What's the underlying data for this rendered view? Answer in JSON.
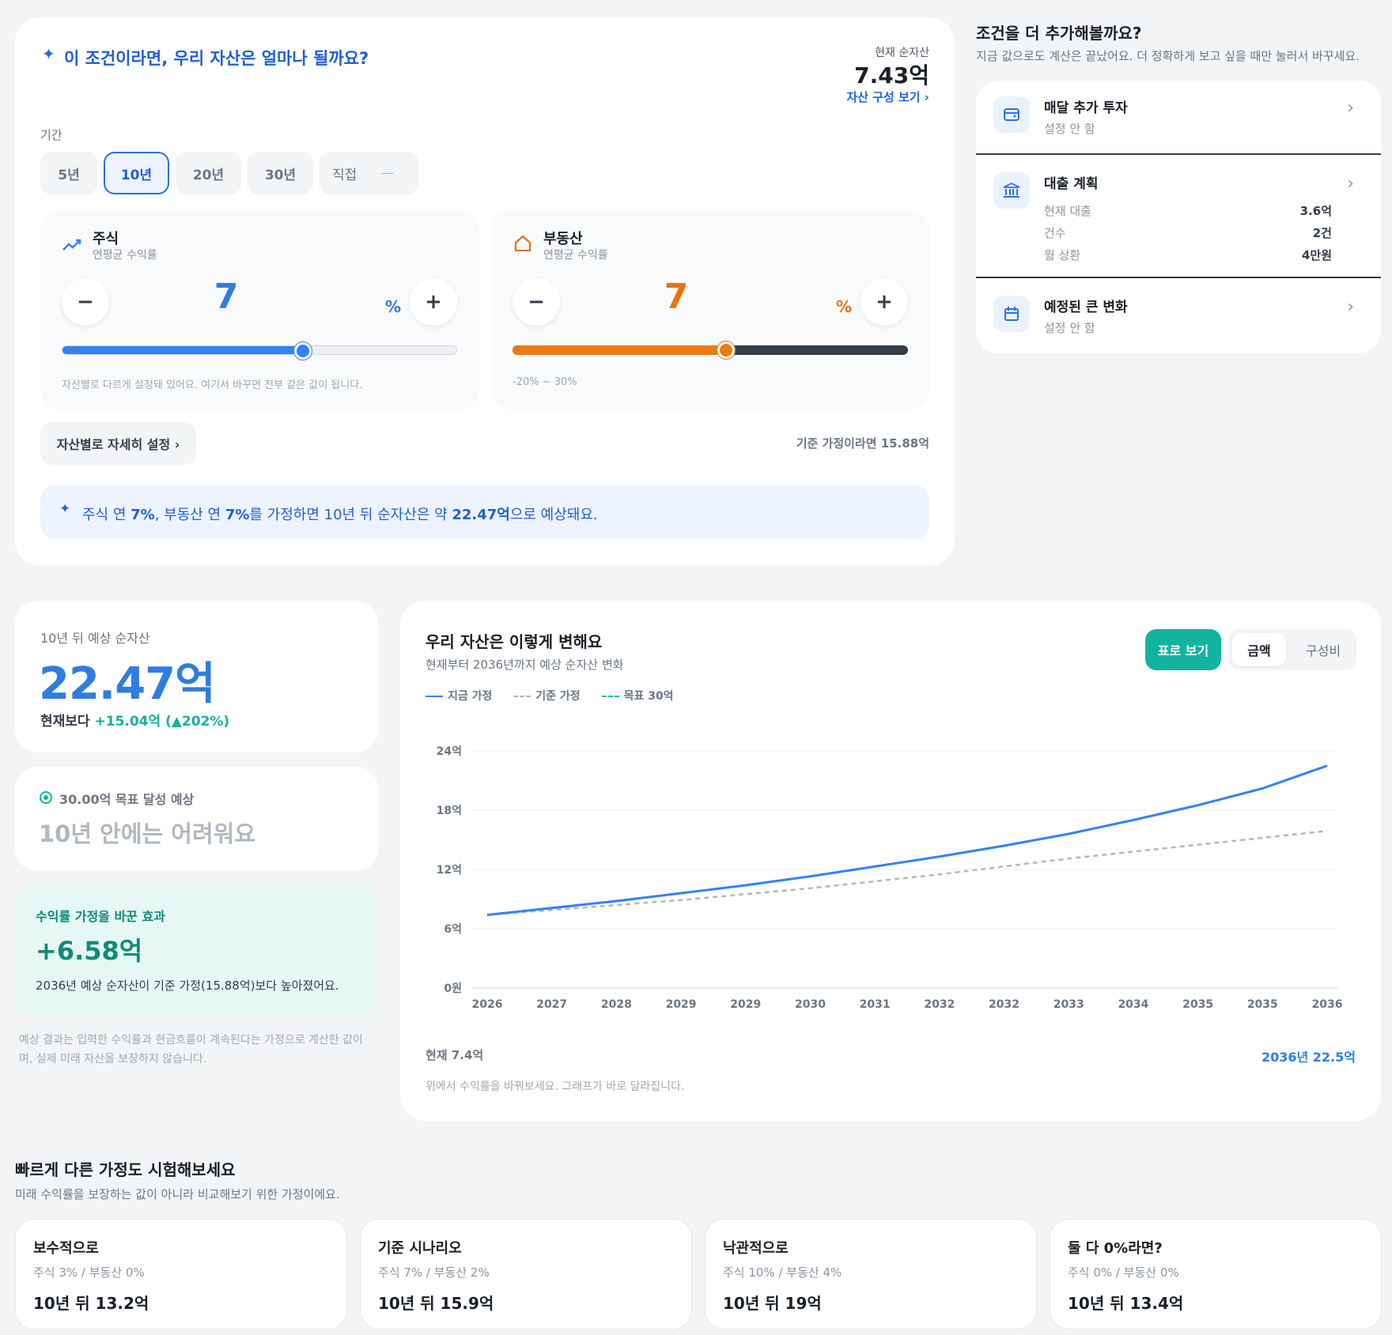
{
  "sim": {
    "title": "이 조건이라면, 우리 자산은 얼마나 될까요?",
    "current_label": "현재 순자산",
    "current_value": "7.43억",
    "composition_link": "자산 구성 보기 ›",
    "period_label": "기간",
    "periods": [
      "5년",
      "10년",
      "20년",
      "30년"
    ],
    "custom_label": "직접",
    "custom_placeholder": "—",
    "stock": {
      "name": "주식",
      "sub": "연평균 수익률",
      "value": "7",
      "unit": "%",
      "minus": "−",
      "plus": "+",
      "slider_fraction": 0.61,
      "note": "자산별로 다르게 설정돼 있어요. 여기서 바꾸면 전부 같은 값이 됩니다."
    },
    "realestate": {
      "name": "부동산",
      "sub": "연평균 수익률",
      "value": "7",
      "unit": "%",
      "minus": "−",
      "plus": "+",
      "slider_fraction": 0.54,
      "range_note": "-20% ~ 30%"
    },
    "detail_button": "자산별로 자세히 설정 ›",
    "baseline_note": "기준 가정이라면 15.88억",
    "summary": {
      "p1": "주식 연 ",
      "b1": "7%",
      "p2": ", 부동산 연 ",
      "b2": "7%",
      "p3": "를 가정하면 10년 뒤 순자산은 약 ",
      "b3": "22.47억",
      "p4": "으로 예상돼요."
    }
  },
  "conditions": {
    "title": "조건을 더 추가해볼까요?",
    "subtitle": "지금 값으로도 계산은 끝났어요. 더 정확하게 보고 싶을 때만 눌러서 바꾸세요.",
    "monthly": {
      "title": "매달 추가 투자",
      "status": "설정 안 함"
    },
    "loan": {
      "title": "대출 계획",
      "rows": [
        {
          "label": "현재 대출",
          "value": "3.6억"
        },
        {
          "label": "건수",
          "value": "2건"
        },
        {
          "label": "월 상환",
          "value": "4만원"
        }
      ]
    },
    "events": {
      "title": "예정된 큰 변화",
      "status": "설정 안 함"
    }
  },
  "result": {
    "label": "10년 뒤 예상 순자산",
    "value": "22.47억",
    "vs_prefix": "현재보다 ",
    "vs_change": "+15.04억 (▲202%)"
  },
  "goal": {
    "label": "30.00억 목표 달성 예상",
    "status": "10년 안에는 어려워요"
  },
  "effect": {
    "label": "수익률 가정을 바꾼 효과",
    "value": "+6.58억",
    "desc": "2036년 예상 순자산이 기준 가정(15.88억)보다 높아졌어요."
  },
  "disclaimer": "예상 결과는 입력한 수익률과 현금흐름이 계속된다는 가정으로 계산한 값이며, 실제 미래 자산을 보장하지 않습니다.",
  "chart_panel": {
    "title": "우리 자산은 이렇게 변해요",
    "subtitle": "현재부터 2036년까지 예상 순자산 변화",
    "table_button": "표로 보기",
    "toggle": [
      "금액",
      "구성비"
    ],
    "footer_left": "현재 7.4억",
    "footer_right": "2036년 22.5억",
    "hint": "위에서 수익률을 바꿔보세요. 그래프가 바로 달라집니다."
  },
  "chart_data": {
    "type": "line",
    "x": [
      "2026",
      "2027",
      "2028",
      "2029",
      "2029",
      "2030",
      "2031",
      "2032",
      "2032",
      "2033",
      "2034",
      "2035",
      "2035",
      "2036"
    ],
    "y_ticks": [
      "24억",
      "18억",
      "12억",
      "6억",
      "0원"
    ],
    "ylim": [
      0,
      24
    ],
    "legend_position": "top-left",
    "series": [
      {
        "name": "지금 가정",
        "color": "#3182f6",
        "style": "solid",
        "values": [
          7.4,
          8.1,
          8.8,
          9.6,
          10.4,
          11.3,
          12.3,
          13.3,
          14.4,
          15.6,
          17.0,
          18.5,
          20.2,
          22.5
        ]
      },
      {
        "name": "기준 가정",
        "color": "#b0b8c1",
        "style": "dashed",
        "values": [
          7.4,
          7.9,
          8.4,
          8.9,
          9.5,
          10.1,
          10.8,
          11.5,
          12.3,
          13.1,
          13.8,
          14.5,
          15.2,
          15.9
        ]
      },
      {
        "name": "목표 30억",
        "color": "#20b8a6",
        "style": "dashed",
        "values": []
      }
    ]
  },
  "scenarios": {
    "title": "빠르게 다른 가정도 시험해보세요",
    "subtitle": "미래 수익률을 보장하는 값이 아니라 비교해보기 위한 가정이에요.",
    "items": [
      {
        "name": "보수적으로",
        "assumption": "주식 3% / 부동산 0%",
        "result": "10년 뒤 13.2억"
      },
      {
        "name": "기준 시나리오",
        "assumption": "주식 7% / 부동산 2%",
        "result": "10년 뒤 15.9억"
      },
      {
        "name": "낙관적으로",
        "assumption": "주식 10% / 부동산 4%",
        "result": "10년 뒤 19억"
      },
      {
        "name": "둘 다 0%라면?",
        "assumption": "주식 0% / 부동산 0%",
        "result": "10년 뒤 13.4억"
      }
    ]
  }
}
